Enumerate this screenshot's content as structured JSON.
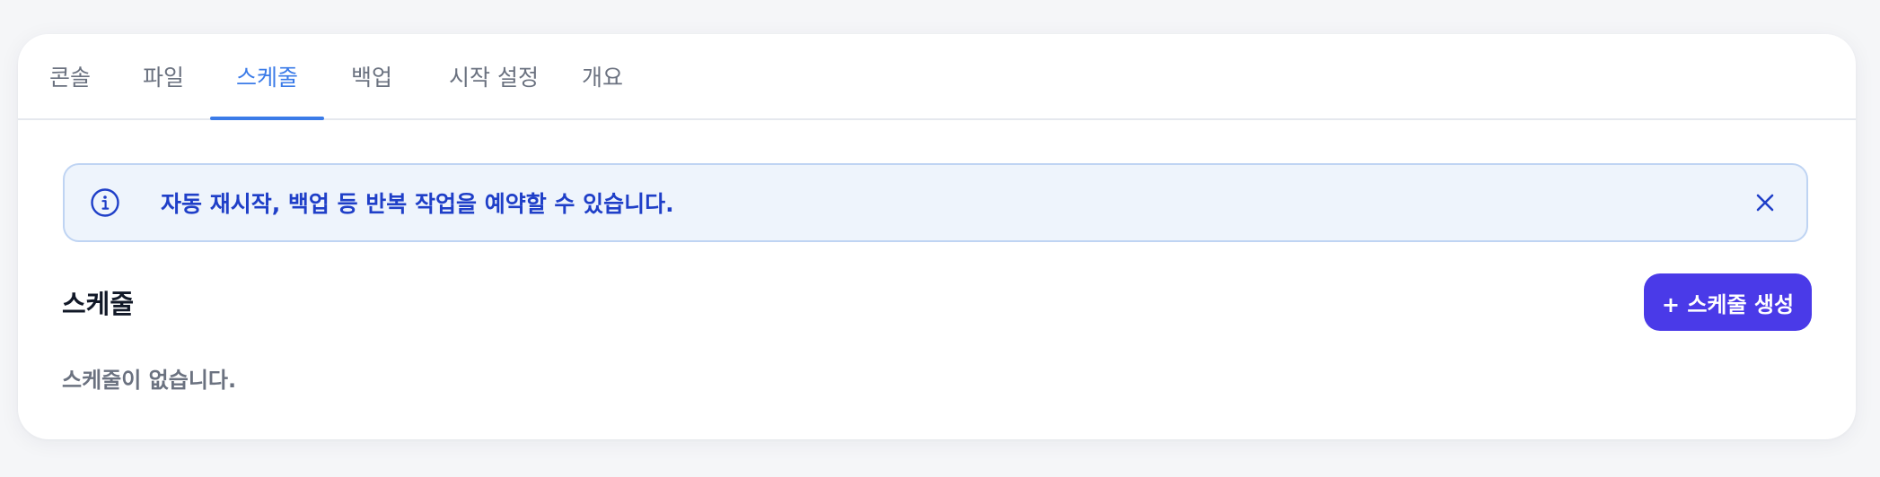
{
  "tabs": [
    {
      "label": "콘솔",
      "active": false
    },
    {
      "label": "파일",
      "active": false
    },
    {
      "label": "스케줄",
      "active": true
    },
    {
      "label": "백업",
      "active": false
    },
    {
      "label": "시작 설정",
      "active": false
    },
    {
      "label": "개요",
      "active": false
    }
  ],
  "alert": {
    "icon": "info-icon",
    "message": "자동 재시작, 백업 등 반복 작업을 예약할 수 있습니다.",
    "close_icon": "close-icon"
  },
  "schedules": {
    "title": "스케줄",
    "create_button_label": "+ 스케줄 생성",
    "empty_message": "스케줄이 없습니다."
  },
  "colors": {
    "accent": "#3b7be8",
    "primary_button": "#4a3ae8",
    "alert_background": "#eef4fc",
    "alert_border": "#bfd4f3",
    "alert_text": "#1f3fc8"
  }
}
